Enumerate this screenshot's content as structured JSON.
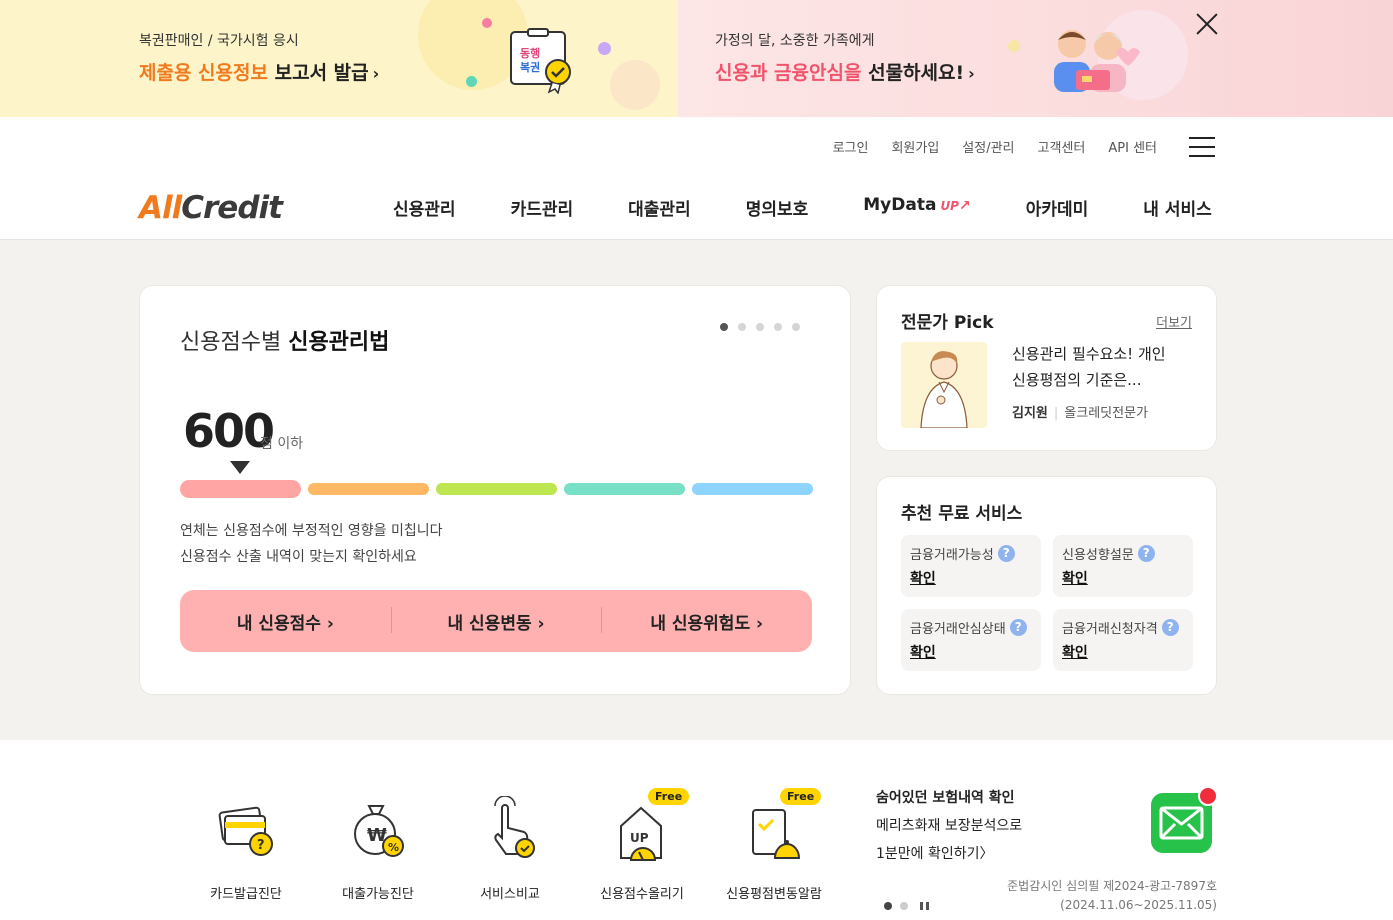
{
  "banner": {
    "left": {
      "sub": "복권판매인 / 국가시험 응시",
      "main_highlight": "제출용 신용정보",
      "main_rest": "보고서 발급",
      "arrow": "›",
      "badge_line1": "동행",
      "badge_line2": "복권"
    },
    "right": {
      "sub": "가정의 달, 소중한 가족에게",
      "main_highlight": "신용과 금융안심을",
      "main_rest": "선물하세요!",
      "arrow": "›"
    }
  },
  "util_nav": [
    "로그인",
    "회원가입",
    "설정/관리",
    "고객센터",
    "API 센터"
  ],
  "logo": {
    "part1": "All",
    "part2": "Credit"
  },
  "gnb": [
    {
      "label": "신용관리"
    },
    {
      "label": "카드관리"
    },
    {
      "label": "대출관리"
    },
    {
      "label": "명의보호"
    },
    {
      "label": "MyData",
      "badge": "UP"
    },
    {
      "label": "아카데미"
    },
    {
      "label": "내 서비스"
    }
  ],
  "score_card": {
    "title_light": "신용점수별",
    "title_bold": "신용관리법",
    "score": "600",
    "score_unit": "점 이하",
    "desc_line1": "연체는 신용점수에 부정적인 영향을 미칩니다",
    "desc_line2": "신용점수 산출 내역이 맞는지 확인하세요",
    "buttons": [
      "내 신용점수 ›",
      "내 신용변동 ›",
      "내 신용위험도 ›"
    ],
    "slide_count": 5,
    "active_slide": 1,
    "active_band": 1,
    "band_colors": [
      "#ffa5a3",
      "#ffb863",
      "#bde650",
      "#78e0c6",
      "#8dd4ff"
    ]
  },
  "expert_pick": {
    "title": "전문가 Pick",
    "more": "더보기",
    "article_line1": "신용관리 필수요소! 개인",
    "article_line2": "신용평점의 기준은...",
    "author": "김지원",
    "author_role": "올크레딧전문가"
  },
  "free_services": {
    "title": "추천 무료 서비스",
    "items": [
      {
        "name": "금융거래가능성",
        "link": "확인"
      },
      {
        "name": "신용성향설문",
        "link": "확인"
      },
      {
        "name": "금융거래안심상태",
        "link": "확인"
      },
      {
        "name": "금융거래신청자격",
        "link": "확인"
      }
    ],
    "help_glyph": "?"
  },
  "quick_menu": [
    {
      "label": "카드발급진단",
      "icon": "card-check-icon",
      "free": ""
    },
    {
      "label": "대출가능진단",
      "icon": "money-bag-icon",
      "free": ""
    },
    {
      "label": "서비스비교",
      "icon": "hand-pointer-icon",
      "free": ""
    },
    {
      "label": "신용점수올리기",
      "icon": "score-up-icon",
      "free": "Free"
    },
    {
      "label": "신용평점변동알람",
      "icon": "alarm-bell-icon",
      "free": "Free"
    }
  ],
  "ad": {
    "line1": "숨어있던 보험내역 확인",
    "line2": "메리츠화재 보장분석으로",
    "line3": "1분만에 확인하기〉"
  },
  "legal": {
    "line1": "준법감시인 심의필 제2024-광고-7897호",
    "line2": "(2024.11.06~2025.11.05)"
  },
  "colors": {
    "brand_orange": "#f07a1e",
    "brand_pink": "#f0546a",
    "button_pink": "#ffb1b1",
    "help_blue": "#8fb3ee",
    "mail_green": "#27c24a"
  }
}
